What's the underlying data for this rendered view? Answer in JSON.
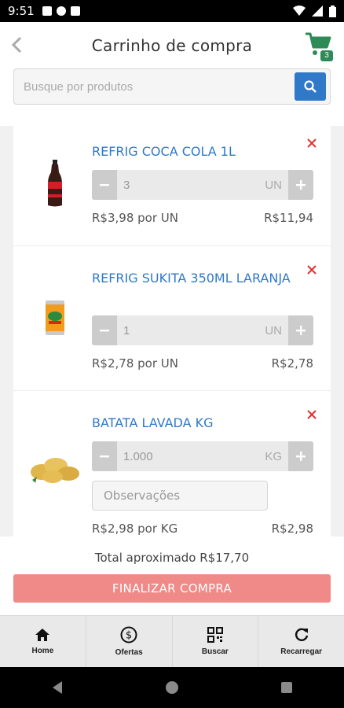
{
  "status_bar": {
    "time": "9:51"
  },
  "header": {
    "title": "Carrinho de compra",
    "cart_count": "3",
    "search_placeholder": "Busque por produtos"
  },
  "items": [
    {
      "name": "REFRIG COCA COLA 1L",
      "quantity": "3",
      "unit": "UN",
      "unit_price": "R$3,98 por UN",
      "total": "R$11,94"
    },
    {
      "name": "REFRIG SUKITA 350ML LARANJA",
      "quantity": "1",
      "unit": "UN",
      "unit_price": "R$2,78 por UN",
      "total": "R$2,78"
    },
    {
      "name": "BATATA LAVADA KG",
      "quantity": "1.000",
      "unit": "KG",
      "unit_price": "R$2,98 por KG",
      "total": "R$2,98",
      "obs_placeholder": "Observações"
    }
  ],
  "footer": {
    "total_text": "Total aproximado R$17,70",
    "finalize_label": "FINALIZAR COMPRA"
  },
  "nav": [
    {
      "label": "Home",
      "icon": "home-icon"
    },
    {
      "label": "Ofertas",
      "icon": "dollar-icon"
    },
    {
      "label": "Buscar",
      "icon": "qrcode-icon"
    },
    {
      "label": "Recarregar",
      "icon": "reload-icon"
    }
  ],
  "colors": {
    "accent": "#2f79c8",
    "cart": "#2e8b57",
    "finalize": "#f08a88",
    "remove": "#dd3333"
  }
}
